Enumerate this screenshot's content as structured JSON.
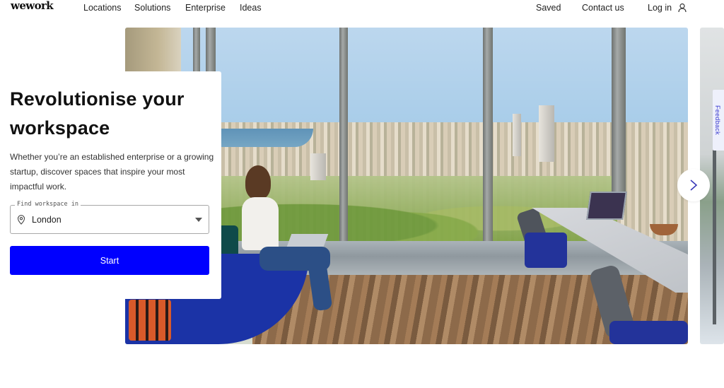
{
  "nav": {
    "logo": "wework",
    "links": [
      {
        "label": "Locations"
      },
      {
        "label": "Solutions"
      },
      {
        "label": "Enterprise"
      },
      {
        "label": "Ideas"
      }
    ],
    "right_links": [
      {
        "label": "Saved"
      },
      {
        "label": "Contact us"
      },
      {
        "label": "Log in"
      }
    ],
    "user_icon": "user-icon"
  },
  "hero": {
    "headline": "Revolutionise your workspace",
    "subtext": "Whether you’re an established enterprise or a growing startup, discover spaces that inspire your most impactful work.",
    "location_field": {
      "label": "Find workspace in",
      "value": "London",
      "icon": "map-pin-icon"
    },
    "start_button": "Start",
    "image_alt": "Woman working on laptop on a blue sofa beside floor-to-ceiling windows overlooking a city"
  },
  "carousel": {
    "next_icon": "chevron-right-icon"
  },
  "feedback_tab": "Feedback",
  "colors": {
    "accent": "#0000ff",
    "text": "#111111",
    "feedback_text": "#3b3bd0"
  }
}
